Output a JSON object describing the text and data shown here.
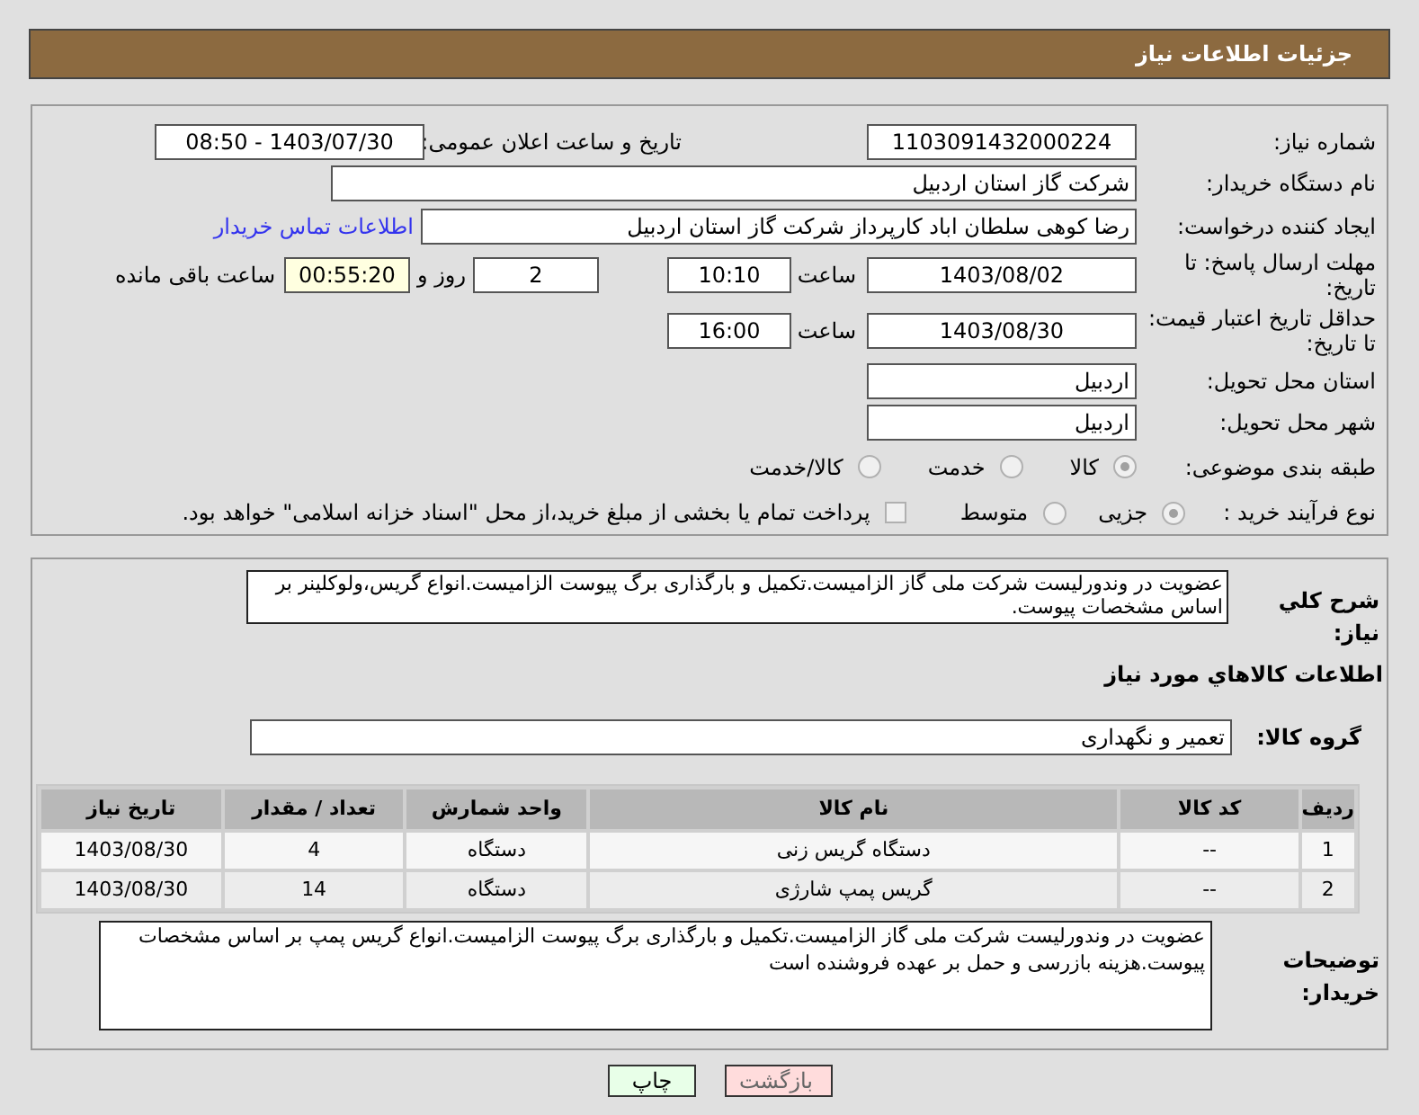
{
  "header": {
    "title": "جزئیات اطلاعات نیاز"
  },
  "need_number": {
    "label": "شماره نیاز:",
    "value": "1103091432000224"
  },
  "announce": {
    "label": "تاریخ و ساعت اعلان عمومی:",
    "value": "1403/07/30 - 08:50"
  },
  "buyer_org": {
    "label": "نام دستگاه خریدار:",
    "value": "شرکت گاز استان اردبیل"
  },
  "creator": {
    "label": "ایجاد کننده درخواست:",
    "value": "رضا کوهی سلطان اباد کارپرداز شرکت گاز استان اردبیل",
    "link": "اطلاعات تماس خریدار"
  },
  "deadline": {
    "label": "مهلت ارسال پاسخ: تا تاریخ:",
    "date": "1403/08/02",
    "time_label": "ساعت",
    "time": "10:10",
    "days": "2",
    "days_label": "روز و",
    "remaining": "00:55:20",
    "remaining_label": "ساعت باقی مانده"
  },
  "validity": {
    "label": "حداقل تاریخ اعتبار قیمت: تا تاریخ:",
    "date": "1403/08/30",
    "time_label": "ساعت",
    "time": "16:00"
  },
  "province": {
    "label": "استان محل تحویل:",
    "value": "اردبیل"
  },
  "city": {
    "label": "شهر محل تحویل:",
    "value": "اردبیل"
  },
  "category": {
    "label": "طبقه بندی موضوعی:",
    "options": [
      {
        "label": "کالا",
        "selected": true
      },
      {
        "label": "خدمت",
        "selected": false
      },
      {
        "label": "کالا/خدمت",
        "selected": false
      }
    ]
  },
  "process": {
    "label": "نوع فرآیند خرید :",
    "options": [
      {
        "label": "جزیی",
        "selected": true
      },
      {
        "label": "متوسط",
        "selected": false
      }
    ],
    "payment": {
      "label": "پرداخت تمام یا بخشی از مبلغ خرید،از محل \"اسناد خزانه اسلامی\" خواهد بود.",
      "checked": false
    }
  },
  "description": {
    "label": "شرح کلي نیاز:",
    "value": "عضویت در وندورلیست شرکت ملی گاز الزامیست.تکمیل و بارگذاری برگ پیوست الزامیست.انواع گریس،ولوکلینر بر اساس مشخصات پیوست."
  },
  "goods": {
    "title": "اطلاعات کالاهاي مورد نیاز",
    "group_label": "گروه کالا:",
    "group": "تعمیر و نگهداری",
    "table": {
      "columns": [
        "ردیف",
        "کد کالا",
        "نام کالا",
        "واحد شمارش",
        "تعداد / مقدار",
        "تاریخ نیاز"
      ],
      "rows": [
        [
          "1",
          "--",
          "دستگاه گریس زنی",
          "دستگاه",
          "4",
          "1403/08/30"
        ],
        [
          "2",
          "--",
          "گریس پمپ شارژی",
          "دستگاه",
          "14",
          "1403/08/30"
        ]
      ]
    }
  },
  "buyer_notes": {
    "label": "توضیحات خریدار:",
    "value": "عضویت در وندورلیست شرکت ملی گاز الزامیست.تکمیل و بارگذاری برگ پیوست الزامیست.انواع گریس پمپ بر اساس مشخصات پیوست.هزینه بازرسی و حمل بر عهده فروشنده است"
  },
  "buttons": [
    {
      "label": "بازگشت",
      "kind": "back"
    },
    {
      "label": "چاپ",
      "kind": "print"
    }
  ]
}
